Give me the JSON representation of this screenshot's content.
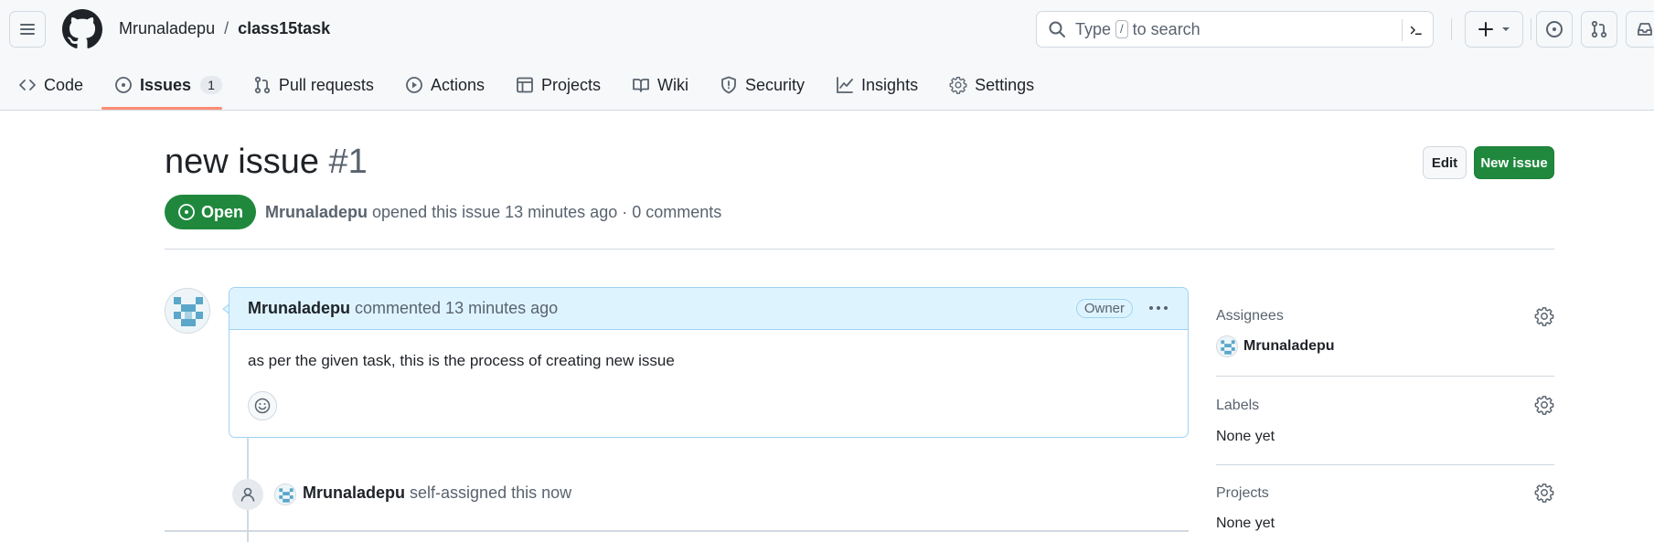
{
  "header": {
    "owner": "Mrunaladepu",
    "separator": "/",
    "repo": "class15task",
    "search_prefix": "Type",
    "search_key": "/",
    "search_suffix": "to search"
  },
  "tabs": [
    {
      "label": "Code"
    },
    {
      "label": "Issues",
      "count": "1"
    },
    {
      "label": "Pull requests"
    },
    {
      "label": "Actions"
    },
    {
      "label": "Projects"
    },
    {
      "label": "Wiki"
    },
    {
      "label": "Security"
    },
    {
      "label": "Insights"
    },
    {
      "label": "Settings"
    }
  ],
  "issue": {
    "title": "new issue",
    "number": "#1",
    "state": "Open",
    "author": "Mrunaladepu",
    "meta": "opened this issue 13 minutes ago · 0 comments",
    "edit_label": "Edit",
    "new_label": "New issue"
  },
  "comment": {
    "author": "Mrunaladepu",
    "time": "commented 13 minutes ago",
    "badge": "Owner",
    "body": "as per the given task, this is the process of creating new issue"
  },
  "event": {
    "actor": "Mrunaladepu",
    "text": "self-assigned this now"
  },
  "sidebar": {
    "assignees_label": "Assignees",
    "assignee": "Mrunaladepu",
    "labels_label": "Labels",
    "labels_value": "None yet",
    "projects_label": "Projects",
    "projects_value": "None yet"
  },
  "colors": {
    "accent_green": "#1f883d",
    "tab_underline": "#fd8c73",
    "comment_header": "#ddf4ff"
  }
}
